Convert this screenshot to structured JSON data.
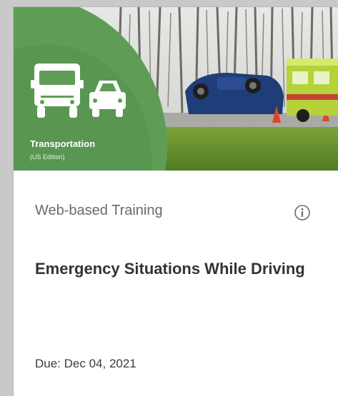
{
  "banner": {
    "category": "Transportation",
    "edition": "(US Edition)",
    "icon": "truck-and-car-icon"
  },
  "card": {
    "type_label": "Web-based Training",
    "info_icon": "info-icon",
    "title": "Emergency Situations While Driving",
    "due": "Due: Dec 04, 2021"
  },
  "colors": {
    "brand_green": "#5f9d57",
    "dark_green": "#4a8443",
    "text_gray": "#6b6b6b",
    "title_text": "#333333"
  }
}
